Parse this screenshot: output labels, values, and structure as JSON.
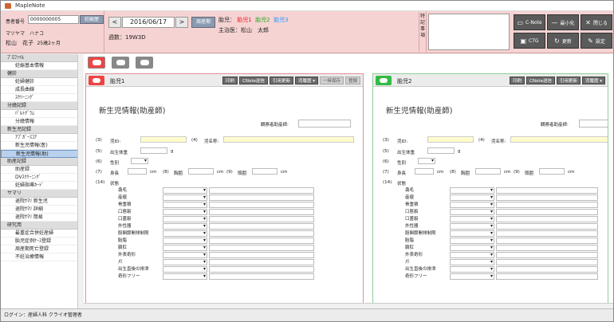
{
  "window": {
    "title": "MapleNote"
  },
  "header": {
    "patient_id_label": "患者番号",
    "patient_id": "0000000005",
    "pregnancy_button": "妊娠歴",
    "name_kana": "マツヤマ　ハナコ",
    "name": "松山　花子",
    "age": "25歳2ヶ月",
    "prev_button": "<",
    "date": "2016/06/17",
    "next_button": ">",
    "cycle_button": "周産期",
    "weeks": "週数：19W3D",
    "fetus_label": "胎児：",
    "fetus1": "胎児1",
    "fetus2": "胎児2",
    "fetus3": "胎児3",
    "doctor": "主治医：松山　太郎",
    "notes_label": "特記事項",
    "cnote_button": "C-Note",
    "minimize_button": "最小化",
    "close_button": "閉じる",
    "ctg_button": "CTG",
    "refresh_button": "更新",
    "settings_button": "設定"
  },
  "sidebar": {
    "items": [
      {
        "label": "ﾌﾟﾛﾌｧｲﾙ",
        "kind": "cat"
      },
      {
        "label": "妊娠基本情報",
        "kind": "sub"
      },
      {
        "label": "健診",
        "kind": "cat"
      },
      {
        "label": "妊婦健診",
        "kind": "sub"
      },
      {
        "label": "成長曲線",
        "kind": "sub"
      },
      {
        "label": "ｽｸﾘｰﾆﾝｸﾞ",
        "kind": "sub"
      },
      {
        "label": "分娩記録",
        "kind": "cat"
      },
      {
        "label": "ﾊﾟﾙﾄｸﾞﾗﾑ",
        "kind": "sub"
      },
      {
        "label": "分娩情報",
        "kind": "sub"
      },
      {
        "label": "新生児記録",
        "kind": "cat"
      },
      {
        "label": "ｱﾌﾟｶﾞｰｽｺｱ",
        "kind": "sub"
      },
      {
        "label": "新生児情報(医)",
        "kind": "sub"
      },
      {
        "label": "新生児情報(助)",
        "kind": "sel"
      },
      {
        "label": "助産記録",
        "kind": "cat"
      },
      {
        "label": "助産録",
        "kind": "sub"
      },
      {
        "label": "DVｽｸﾘｰﾆﾝｸﾞ",
        "kind": "sub"
      },
      {
        "label": "妊婦指導ｶｰﾄﾞ",
        "kind": "sub"
      },
      {
        "label": "サマリ",
        "kind": "cat"
      },
      {
        "label": "退院ｻﾏﾘ 新生児",
        "kind": "sub"
      },
      {
        "label": "退院ｻﾏﾘ 詳細",
        "kind": "sub"
      },
      {
        "label": "退院ｻﾏﾘ 簡易",
        "kind": "sub"
      },
      {
        "label": "研究用",
        "kind": "cat"
      },
      {
        "label": "最重症合併妊産婦",
        "kind": "sub"
      },
      {
        "label": "胎児症例ｹｰｽ登録",
        "kind": "sub"
      },
      {
        "label": "周産期死亡登録",
        "kind": "sub"
      },
      {
        "label": "不妊治療情報",
        "kind": "sub"
      }
    ]
  },
  "panels": [
    {
      "title": "胎児1",
      "buttons": [
        "印刷",
        "CNote送信",
        "引用更新",
        "児履歴 ▾",
        "一時保存",
        "登録"
      ],
      "form_title": "新生児情報(助産師)",
      "observer_label": "観察者助産師:",
      "child_id_label": "児ID:",
      "child_name_label": "児名称:",
      "n3": "(3)",
      "n4": "(4)",
      "n5": "(5)",
      "n6": "(6)",
      "n7": "(7)",
      "n8": "(8)",
      "n9": "(9)",
      "n14": "(14)",
      "birth_weight_label": "出生体重",
      "g_unit": "g",
      "sex_label": "性別",
      "height_label": "身長",
      "chest_label": "胸囲",
      "head_label": "頭囲",
      "cm": "cm",
      "state_label": "状態",
      "states": [
        "毳毛",
        "産瘤",
        "骨重積",
        "口唇裂",
        "口蓋裂",
        "外性器",
        "股関節開排制限",
        "胎脂",
        "臍肛",
        "外表奇形",
        "爪",
        "出生直後の排泄",
        "奇形フリー"
      ]
    },
    {
      "title": "胎児2",
      "buttons": [
        "印刷",
        "CNote送信",
        "引用更新",
        "児履歴 ▾"
      ],
      "form_title": "新生児情報(助産師)",
      "observer_label": "観察者助産師:",
      "child_id_label": "児ID:",
      "child_name_label": "児名称:",
      "n3": "(3)",
      "n4": "(4)",
      "n5": "(5)",
      "n6": "(6)",
      "n7": "(7)",
      "n8": "(8)",
      "n9": "(9)",
      "n14": "(14)",
      "birth_weight_label": "出生体重",
      "g_unit": "g",
      "sex_label": "性別",
      "height_label": "身長",
      "chest_label": "胸囲",
      "head_label": "頭囲",
      "cm": "cm",
      "state_label": "状態",
      "states": [
        "毳毛",
        "産瘤",
        "骨重積",
        "口唇裂",
        "口蓋裂",
        "外性器",
        "股関節開排制限",
        "胎脂",
        "臍肛",
        "外表奇形",
        "爪",
        "出生直後の排泄",
        "奇形フリー"
      ]
    }
  ],
  "status": {
    "login": "ログイン：産婦人科 クライオ管理者"
  },
  "colors": {
    "header_bg": "#f6d3d3",
    "fetus1": "#e22",
    "fetus2": "#2a2",
    "fetus3": "#29f",
    "selected_nav": "#b9d1ec"
  }
}
